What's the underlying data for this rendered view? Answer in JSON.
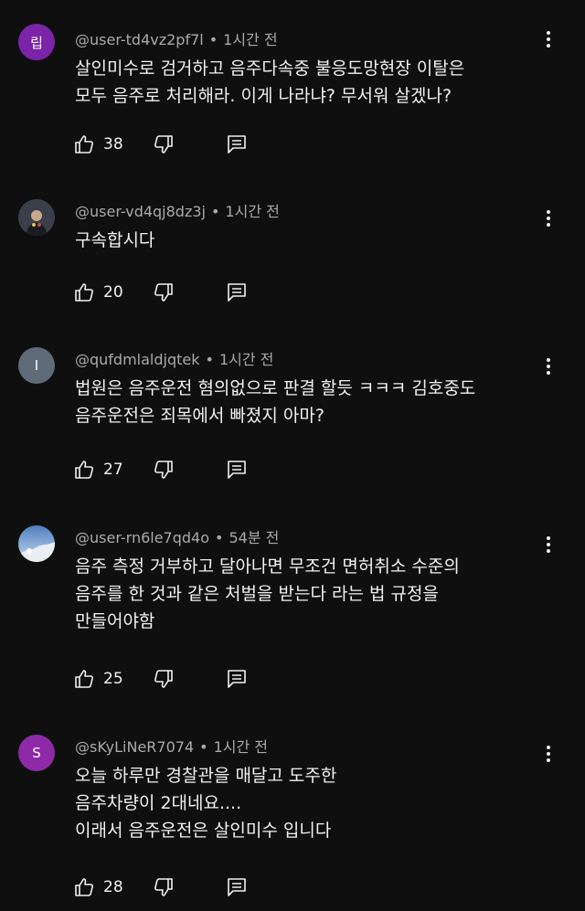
{
  "comments": [
    {
      "user": "@user-td4vz2pf7l",
      "time": "1시간 전",
      "avatar_text": "립",
      "avatar_color": "#7b24a8",
      "lines": [
        "살인미수로 검거하고 음주다속중 불응도망현장 이탈은",
        "모두 음주로 처리해라. 이게 나라냐? 무서워 살겠나?"
      ],
      "likes": "38"
    },
    {
      "user": "@user-vd4qj8dz3j",
      "time": "1시간 전",
      "avatar_text": "",
      "avatar_color": "#2a2f3a",
      "lines": [
        "구속합시다"
      ],
      "likes": "20"
    },
    {
      "user": "@qufdmlaldjqtek",
      "time": "1시간 전",
      "avatar_text": "I",
      "avatar_color": "#5f6b78",
      "lines": [
        "법원은 음주운전 혐의없으로 판결 할듯 ㅋㅋㅋ 김호중도",
        "음주운전은 죄목에서 빠졌지 아마?"
      ],
      "likes": "27"
    },
    {
      "user": "@user-rn6le7qd4o",
      "time": "54분 전",
      "avatar_text": "",
      "avatar_color": "#7d9ec7",
      "lines": [
        "음주 측정 거부하고 달아나면 무조건 면허취소 수준의",
        "음주를 한 것과 같은 처벌을 받는다 라는 법 규정을",
        "만들어야함"
      ],
      "likes": "25"
    },
    {
      "user": "@sKyLiNeR7074",
      "time": "1시간 전",
      "avatar_text": "S",
      "avatar_color": "#8e2aa8",
      "lines": [
        "오늘 하루만 경찰관을 매달고 도주한",
        "음주차량이 2대네요....",
        "이래서 음주운전은 살인미수 입니다"
      ],
      "likes": "28"
    }
  ]
}
